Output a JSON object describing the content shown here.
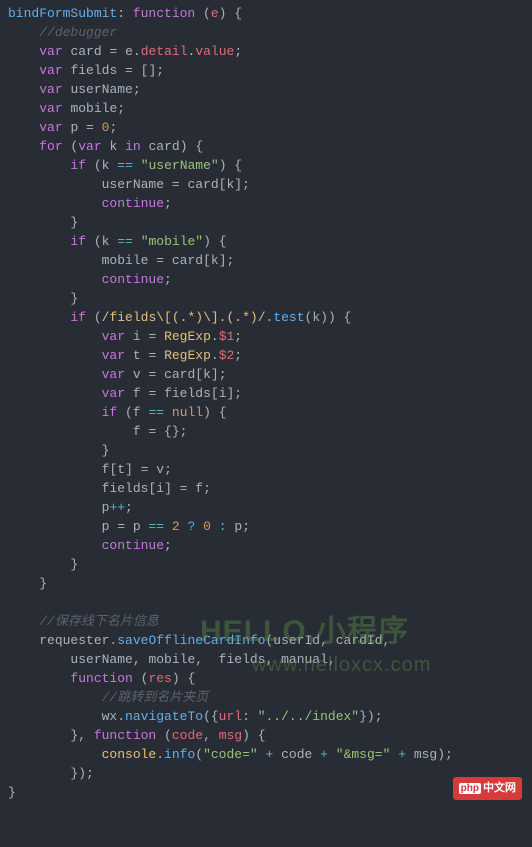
{
  "code": {
    "l1": {
      "fn": "bindFormSubmit",
      "kw": "function",
      "param": "e"
    },
    "l2": {
      "cmt": "//debugger"
    },
    "l3": {
      "kw": "var",
      "id": "card",
      "rhs_obj": "e",
      "rhs_prop1": "detail",
      "rhs_prop2": "value"
    },
    "l4": {
      "kw": "var",
      "id": "fields"
    },
    "l5": {
      "kw": "var",
      "id": "userName"
    },
    "l6": {
      "kw": "var",
      "id": "mobile"
    },
    "l7": {
      "kw": "var",
      "id": "p",
      "val": "0"
    },
    "l8": {
      "kw_for": "for",
      "kw_var": "var",
      "id": "k",
      "kw_in": "in",
      "iter": "card"
    },
    "l9": {
      "kw_if": "if",
      "lhs": "k",
      "op": "==",
      "str": "\"userName\""
    },
    "l10": {
      "lhs": "userName",
      "rhs_id": "card",
      "rhs_key": "k"
    },
    "l11": {
      "kw": "continue"
    },
    "l13": {
      "kw_if": "if",
      "lhs": "k",
      "op": "==",
      "str": "\"mobile\""
    },
    "l14": {
      "lhs": "mobile",
      "rhs_id": "card",
      "rhs_key": "k"
    },
    "l15": {
      "kw": "continue"
    },
    "l17": {
      "kw_if": "if",
      "re_body": "fields\\[(.*)\\].(.*)",
      "fn": "test",
      "arg": "k"
    },
    "l18": {
      "kw": "var",
      "id": "i",
      "builtin": "RegExp",
      "prop": "$1"
    },
    "l19": {
      "kw": "var",
      "id": "t",
      "builtin": "RegExp",
      "prop": "$2"
    },
    "l20": {
      "kw": "var",
      "id": "v",
      "rhs_id": "card",
      "rhs_key": "k"
    },
    "l21": {
      "kw": "var",
      "id": "f",
      "rhs_id": "fields",
      "rhs_key": "i"
    },
    "l22": {
      "kw_if": "if",
      "lhs": "f",
      "op": "==",
      "rhs": "null"
    },
    "l23": {
      "lhs": "f"
    },
    "l25": {
      "lhs": "f",
      "key": "t",
      "rhs": "v"
    },
    "l26": {
      "lhs": "fields",
      "key": "i",
      "rhs": "f"
    },
    "l27": {
      "id": "p",
      "op": "++"
    },
    "l28": {
      "lhs": "p",
      "id": "p",
      "op": "==",
      "n2": "2",
      "q": "?",
      "n0": "0",
      "colon": ":",
      "rhs": "p"
    },
    "l29": {
      "kw": "continue"
    },
    "l_cmt_save": {
      "cmt": "//保存线下名片信息"
    },
    "l_call": {
      "obj": "requester",
      "fn": "saveOfflineCardInfo",
      "a1": "userId",
      "a2": "cardId"
    },
    "l_call2": {
      "a3": "userName",
      "a4": "mobile",
      "a5": "fields",
      "a6": "manual"
    },
    "l_cb": {
      "kw": "function",
      "param": "res"
    },
    "l_cmt_nav": {
      "cmt": "//跳转到名片夹页"
    },
    "l_wx": {
      "obj": "wx",
      "fn": "navigateTo",
      "key": "url",
      "val": "\"../../index\""
    },
    "l_cb2": {
      "kw": "function",
      "p1": "code",
      "p2": "msg"
    },
    "l_log": {
      "obj": "console",
      "fn": "info",
      "s1": "\"code=\"",
      "v1": "code",
      "s2": "\"&msg=\"",
      "v2": "msg"
    }
  },
  "watermark": {
    "line1": "HELLO,小程序",
    "line2": "www.helloxcx.com"
  },
  "badge": {
    "prefix": "php",
    "text": "中文网"
  }
}
